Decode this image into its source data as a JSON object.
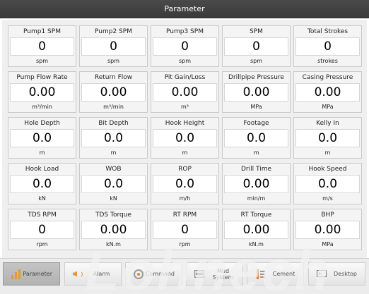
{
  "window": {
    "title": "Parameter"
  },
  "cards": [
    {
      "label": "Pump1 SPM",
      "value": "0",
      "unit": "spm"
    },
    {
      "label": "Pump2 SPM",
      "value": "0",
      "unit": "spm"
    },
    {
      "label": "Pump3 SPM",
      "value": "0",
      "unit": "spm"
    },
    {
      "label": "SPM",
      "value": "0",
      "unit": "spm"
    },
    {
      "label": "Total Strokes",
      "value": "0",
      "unit": "strokes"
    },
    {
      "label": "Pump Flow Rate",
      "value": "0.00",
      "unit": "m³/min"
    },
    {
      "label": "Return Flow",
      "value": "0.00",
      "unit": "m³/min"
    },
    {
      "label": "Pit Gain/Loss",
      "value": "0.00",
      "unit": "m³"
    },
    {
      "label": "Drillpipe Pressure",
      "value": "0.00",
      "unit": "MPa"
    },
    {
      "label": "Casing Pressure",
      "value": "0.00",
      "unit": "MPa"
    },
    {
      "label": "Hole Depth",
      "value": "0.0",
      "unit": "m"
    },
    {
      "label": "Bit Depth",
      "value": "0.0",
      "unit": "m"
    },
    {
      "label": "Hook Height",
      "value": "0.0",
      "unit": "m"
    },
    {
      "label": "Footage",
      "value": "0.0",
      "unit": "m"
    },
    {
      "label": "Kelly In",
      "value": "0.0",
      "unit": "m"
    },
    {
      "label": "Hook Load",
      "value": "0.0",
      "unit": "kN"
    },
    {
      "label": "WOB",
      "value": "0.0",
      "unit": "kN"
    },
    {
      "label": "ROP",
      "value": "0.0",
      "unit": "m/h"
    },
    {
      "label": "Drill Time",
      "value": "0.00",
      "unit": "min/m"
    },
    {
      "label": "Hook Speed",
      "value": "0.0",
      "unit": "m/s"
    },
    {
      "label": "TDS RPM",
      "value": "0",
      "unit": "rpm"
    },
    {
      "label": "TDS Torque",
      "value": "0.00",
      "unit": "kN.m"
    },
    {
      "label": "RT RPM",
      "value": "0",
      "unit": "rpm"
    },
    {
      "label": "RT Torque",
      "value": "0.00",
      "unit": "kN.m"
    },
    {
      "label": "BHP",
      "value": "0.00",
      "unit": "MPa"
    }
  ],
  "taskbar": [
    {
      "label": "Parameter",
      "icon": "bar-chart-icon",
      "active": true
    },
    {
      "label": "Alarm",
      "icon": "speaker-icon",
      "active": false
    },
    {
      "label": "Command",
      "icon": "command-dial-icon",
      "active": false
    },
    {
      "label": "Mud System",
      "icon": "mud-system-icon",
      "active": false
    },
    {
      "label": "Cement",
      "icon": "cement-icon",
      "active": false
    },
    {
      "label": "Desktop",
      "icon": "desktop-icon",
      "active": false
    }
  ],
  "watermark": {
    "text": "Lohnech"
  },
  "colors": {
    "titlebar": "#3f3f3f",
    "accent": "#e59a2c",
    "active_tab": "#b9b9b9"
  }
}
